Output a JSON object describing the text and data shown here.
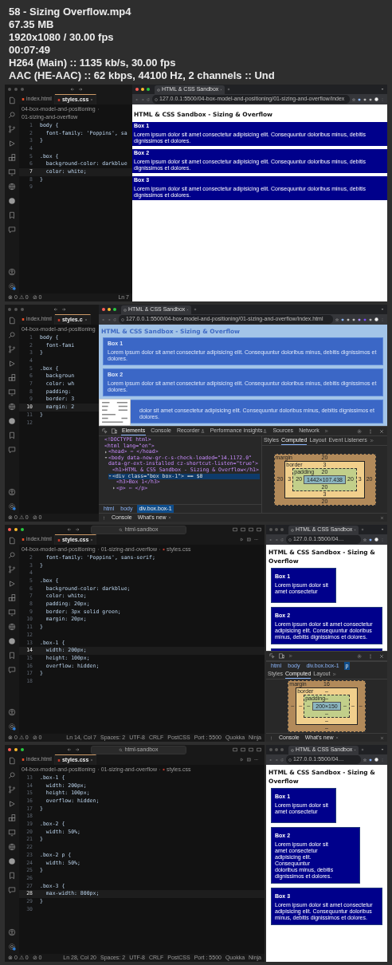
{
  "info": {
    "lines": [
      "58 - Sizing Overflow.mp4",
      "67.35 MB",
      "1920x1080 / 30.00 fps",
      "00:07:49",
      "H264 (Main) :: 1135 kb/s, 30.00 fps",
      "AAC (HE-AAC) :: 62 kbps, 44100 Hz, 2 channels :: Und"
    ]
  },
  "frames": [
    {
      "kind": "browser-wide",
      "editor": {
        "window_focused": false,
        "tabs": [
          {
            "label": "index.html",
            "selected": false
          },
          {
            "label": "styles.css",
            "selected": true
          }
        ],
        "breadcrumb": [
          "04-box-model-and-positioning",
          "01-sizing-and-overflow"
        ],
        "lines": [
          {
            "num": "1",
            "code": "body {",
            "current": false
          },
          {
            "num": "2",
            "code": "  font-family: 'Poppins', sa",
            "current": false
          },
          {
            "num": "3",
            "code": "}",
            "current": false
          },
          {
            "num": "4",
            "current": false
          },
          {
            "num": "5",
            "code": ".box {",
            "current": false
          },
          {
            "num": "6",
            "code": "  background-color: darkblue",
            "current": false
          },
          {
            "num": "7",
            "code": "  color: white;",
            "current": true
          },
          {
            "num": "8",
            "code": "}",
            "current": false
          },
          {
            "num": "9",
            "current": false
          }
        ],
        "status_left": [
          "⊗ 0 ⚠ 0",
          "⊘ 0"
        ],
        "status_right": [
          "Ln 7"
        ]
      },
      "browser": {
        "window_focused": true,
        "tab_title": "HTML & CSS Sandbox",
        "url": "127.0.0.1:5500/04-box-model-and-positioning/01-sizing-and-overflow/index",
        "highlight": false,
        "inspect_tooltip": false,
        "page": {
          "heading": "HTML & CSS Sandbox - Sizing & Overflow",
          "boxes": [
            {
              "kind": "plain",
              "title": "Box 1",
              "text": "Lorem ipsum dolor sit amet consectetur adipisicing elit. Consequuntur doloribus minus, debitis dignissimos et dolores."
            },
            {
              "kind": "plain",
              "title": "Box 2",
              "text": "Lorem ipsum dolor sit amet consectetur adipisicing elit. Consequuntur doloribus minus, debitis dignissimos et dolores."
            },
            {
              "kind": "plain",
              "title": "Box 3",
              "text": "Lorem ipsum dolor sit amet consectetur adipisicing elit. Consequuntur doloribus minus, debitis dignissimos et dolores."
            }
          ]
        }
      }
    },
    {
      "kind": "devtools-split",
      "editor": {
        "window_focused": false,
        "tabs": [
          {
            "label": "index.html",
            "selected": false
          },
          {
            "label": "styles.c",
            "selected": true
          }
        ],
        "breadcrumb": [
          "04-box-model-and-positioning"
        ],
        "lines": [
          {
            "num": "1",
            "code": "body {",
            "current": false
          },
          {
            "num": "2",
            "code": "  font-fami",
            "current": false
          },
          {
            "num": "3",
            "code": "}",
            "current": false
          },
          {
            "num": "4",
            "current": false
          },
          {
            "num": "5",
            "code": ".box {",
            "current": false
          },
          {
            "num": "6",
            "code": "  backgroun",
            "current": false
          },
          {
            "num": "7",
            "code": "  color: wh",
            "current": false
          },
          {
            "num": "8",
            "code": "  padding:",
            "current": false
          },
          {
            "num": "9",
            "code": "  border: 3",
            "current": false
          },
          {
            "num": "10",
            "code": "  margin: 2",
            "current": true
          },
          {
            "num": "11",
            "code": "}",
            "current": false
          },
          {
            "num": "12",
            "current": false
          }
        ],
        "status_left": [
          "⊗ 0 ⚠ 0",
          "⊘ 0"
        ]
      },
      "browser": {
        "window_focused": true,
        "tab_title": "HTML & CSS Sandbox",
        "url": "127.0.0.1:5500/04-box-model-and-positioning/01-sizing-and-overflow/index.html",
        "highlight": true,
        "inspect_tooltip": true,
        "page": {
          "heading": "HTML & CSS Sandbox - Sizing & Overflow",
          "boxes": [
            {
              "kind": "wide",
              "title": "Box 1",
              "text": "Lorem ipsum dolor sit amet consectetur adipisicing elit. Consequuntur doloribus minus, debitis dignissimos et dolores."
            },
            {
              "kind": "wide",
              "title": "Box 2",
              "text": "Lorem ipsum dolor sit amet consectetur adipisicing elit. Consequuntur doloribus minus, debitis dignissimos et dolores."
            },
            {
              "kind": "wide-covered",
              "text": "dolor sit amet consectetur adipisicing elit. Consequuntur doloribus minus, debitis dignissimos et dolores."
            }
          ]
        },
        "devtools": {
          "kind": "full",
          "tabs": [
            {
              "label": "Elements",
              "selected": true,
              "beta": false
            },
            {
              "label": "Console",
              "selected": false,
              "beta": false
            },
            {
              "label": "Recorder",
              "selected": false,
              "beta": true
            },
            {
              "label": "Performance insights",
              "selected": false,
              "beta": true
            },
            {
              "label": "Sources",
              "selected": false,
              "beta": false
            },
            {
              "label": "Network",
              "selected": false,
              "beta": false
            }
          ],
          "dom": [
            {
              "text": "<!DOCTYPE html>",
              "selected": false
            },
            {
              "text": "<html lang=\"en\">",
              "selected": false,
              "children": [
                {
                  "text": "<head> ⋯ </head>",
                  "selected": false,
                  "expanded": false
                },
                {
                  "text": "<body data-new-gr-c-s-check-loaded=\"14.1172.0\" data-gr-ext-installed cz-shortcut-listen=\"true\">",
                  "selected": false,
                  "expanded": true,
                  "children": [
                    {
                      "text": "<h1>HTML & CSS Sandbox - Sizing & Overflow</h1>",
                      "selected": false
                    },
                    {
                      "text": "<div class=\"box box-1\"> == $0",
                      "selected": true,
                      "expanded": true,
                      "children": [
                        {
                          "text": "<h3>Box 1</h3>",
                          "selected": false
                        },
                        {
                          "text": "<p> ⋯ </p>",
                          "selected": false,
                          "expanded": false
                        }
                      ]
                    }
                  ]
                }
              ]
            }
          ],
          "path": [
            {
              "label": "html",
              "selected": false
            },
            {
              "label": "body",
              "selected": false
            },
            {
              "label": "div.box.box-1",
              "selected": true
            }
          ],
          "side_tabs": [
            {
              "label": "Styles",
              "selected": false
            },
            {
              "label": "Computed",
              "selected": true
            },
            {
              "label": "Layout",
              "selected": false
            },
            {
              "label": "Event Listeners",
              "selected": false
            }
          ],
          "box_model": {
            "layers": [
              {
                "label": "margin",
                "values": [
                  "20",
                  "20",
                  "20",
                  "20"
                ]
              },
              {
                "label": "border",
                "values": [
                  "3",
                  "3",
                  "3",
                  "3"
                ]
              },
              {
                "label": "padding",
                "values": [
                  "20",
                  "20",
                  "20",
                  "20"
                ]
              }
            ],
            "content": "1442×107.438"
          },
          "drawer": [
            {
              "label": "Console",
              "closable": false
            },
            {
              "label": "What's new",
              "closable": true
            }
          ]
        }
      }
    },
    {
      "kind": "editor-wide",
      "editor": {
        "window_focused": true,
        "search": "html-sandbox",
        "tabs": [
          {
            "label": "index.html",
            "selected": false
          },
          {
            "label": "styles.css",
            "selected": true
          }
        ],
        "breadcrumb": [
          "04-box-model-and-positioning",
          "01-sizing-and-overflow",
          "styles.css"
        ],
        "lines": [
          {
            "num": "2",
            "code": "  font-family: 'Poppins', sans-serif;",
            "current": false
          },
          {
            "num": "3",
            "code": "}",
            "current": false
          },
          {
            "num": "4",
            "current": false
          },
          {
            "num": "5",
            "code": ".box {",
            "current": false
          },
          {
            "num": "6",
            "code": "  background-color: darkblue;",
            "current": false
          },
          {
            "num": "7",
            "code": "  color: white;",
            "current": false
          },
          {
            "num": "8",
            "code": "  padding: 20px;",
            "current": false
          },
          {
            "num": "9",
            "code": "  border: 3px solid green;",
            "current": false
          },
          {
            "num": "10",
            "code": "  margin: 20px;",
            "current": false
          },
          {
            "num": "11",
            "code": "}",
            "current": false
          },
          {
            "num": "12",
            "current": false
          },
          {
            "num": "13",
            "code": ".box-1 {",
            "current": false
          },
          {
            "num": "14",
            "code": "  width: 200px;",
            "current": true
          },
          {
            "num": "15",
            "code": "  height: 100px;",
            "current": false
          },
          {
            "num": "16",
            "code": "  overflow: hidden;",
            "current": false
          },
          {
            "num": "17",
            "code": "}",
            "current": false
          },
          {
            "num": "18",
            "current": false
          }
        ],
        "status_left": [
          "⊗ 0 ⚠ 0",
          "⊘ 0"
        ],
        "status_right": [
          "Ln 14, Col 7",
          "Spaces: 2",
          "UTF-8",
          "CRLF",
          "PostCSS",
          "Port : 5500",
          "Quokka",
          "Ninja"
        ]
      },
      "browser": {
        "window_focused": false,
        "tab_title": "HTML & CSS Sandbox",
        "url": "127.0.0.1:5500/04…",
        "highlight": false,
        "inspect_tooltip": false,
        "page": {
          "heading": "HTML & CSS Sandbox - Sizing & Overflow",
          "boxes": [
            {
              "kind": "fixed",
              "title": "Box 1",
              "text": "Lorem ipsum dolor sit amet consectetur"
            },
            {
              "kind": "block",
              "title": "Box 2",
              "text": "Lorem ipsum dolor sit amet consectetur adipisicing elit. Consequuntur doloribus minus, debitis dignissimos et dolores."
            },
            {
              "kind": "block"
            }
          ]
        },
        "devtools": {
          "kind": "compact",
          "path": [
            {
              "label": "html",
              "selected": false
            },
            {
              "label": "body",
              "selected": false
            },
            {
              "label": "div.box.box-1",
              "selected": false
            },
            {
              "label": "p",
              "selected": true
            }
          ],
          "side_tabs": [
            {
              "label": "Styles",
              "selected": false
            },
            {
              "label": "Computed",
              "selected": true
            },
            {
              "label": "Layout",
              "selected": false
            }
          ],
          "box_model": {
            "layers": [
              {
                "label": "margin",
                "values": [
                  "16",
                  "–",
                  "–",
                  "–"
                ]
              },
              {
                "label": "border",
                "values": [
                  "–",
                  "–",
                  "–",
                  "–"
                ]
              },
              {
                "label": "padding",
                "values": [
                  "–",
                  "–",
                  "–",
                  "–"
                ]
              }
            ],
            "content": "200×150"
          },
          "drawer": [
            {
              "label": "Console",
              "closable": false
            },
            {
              "label": "What's new",
              "closable": true
            }
          ]
        }
      }
    },
    {
      "kind": "editor-wide",
      "editor": {
        "window_focused": true,
        "search": "html-sandbox",
        "tabs": [
          {
            "label": "index.html",
            "selected": false
          },
          {
            "label": "styles.css",
            "selected": true
          }
        ],
        "breadcrumb": [
          "04-box-model-and-positioning",
          "01-sizing-and-overflow",
          "styles.css"
        ],
        "lines": [
          {
            "num": "13",
            "code": ".box-1 {",
            "current": false
          },
          {
            "num": "14",
            "code": "  width: 200px;",
            "current": false
          },
          {
            "num": "15",
            "code": "  height: 100px;",
            "current": false
          },
          {
            "num": "16",
            "code": "  overflow: hidden;",
            "current": false
          },
          {
            "num": "17",
            "code": "}",
            "current": false
          },
          {
            "num": "18",
            "current": false
          },
          {
            "num": "19",
            "code": ".box-2 {",
            "current": false
          },
          {
            "num": "20",
            "code": "  width: 50%;",
            "current": false
          },
          {
            "num": "21",
            "code": "}",
            "current": false
          },
          {
            "num": "22",
            "current": false
          },
          {
            "num": "23",
            "code": ".box-2 p {",
            "current": false
          },
          {
            "num": "24",
            "code": "  width: 50%;",
            "current": false
          },
          {
            "num": "25",
            "code": "}",
            "current": false
          },
          {
            "num": "26",
            "current": false
          },
          {
            "num": "27",
            "code": ".box-3 {",
            "current": false
          },
          {
            "num": "28",
            "code": "  max-width: 800px;",
            "current": true
          },
          {
            "num": "29",
            "code": "}",
            "current": false
          },
          {
            "num": "30",
            "current": false
          }
        ],
        "status_left": [
          "⊗ 0 ⚠ 0",
          "⊘ 0"
        ],
        "status_right": [
          "Ln 28, Col 20",
          "Spaces: 2",
          "UTF-8",
          "CRLF",
          "PostCSS",
          "Port : 5500",
          "Quokka",
          "Ninja"
        ]
      },
      "browser": {
        "window_focused": false,
        "tab_title": "HTML & CSS Sandbox",
        "url": "127.0.0.1:5500/04…",
        "highlight": false,
        "inspect_tooltip": false,
        "page": {
          "heading": "HTML & CSS Sandbox - Sizing & Overflow",
          "boxes": [
            {
              "kind": "fixed",
              "title": "Box 1",
              "text": "Lorem ipsum dolor sit amet consectetur"
            },
            {
              "kind": "half",
              "title": "Box 2",
              "text": "Lorem ipsum dolor sit amet consectetur adipisicing elit. Consequuntur doloribus minus, debitis dignissimos et dolores."
            },
            {
              "kind": "block",
              "title": "Box 3",
              "text": "Lorem ipsum dolor sit amet consectetur adipisicing elit. Consequuntur doloribus minus, debitis dignissimos et dolores."
            }
          ]
        }
      }
    }
  ]
}
